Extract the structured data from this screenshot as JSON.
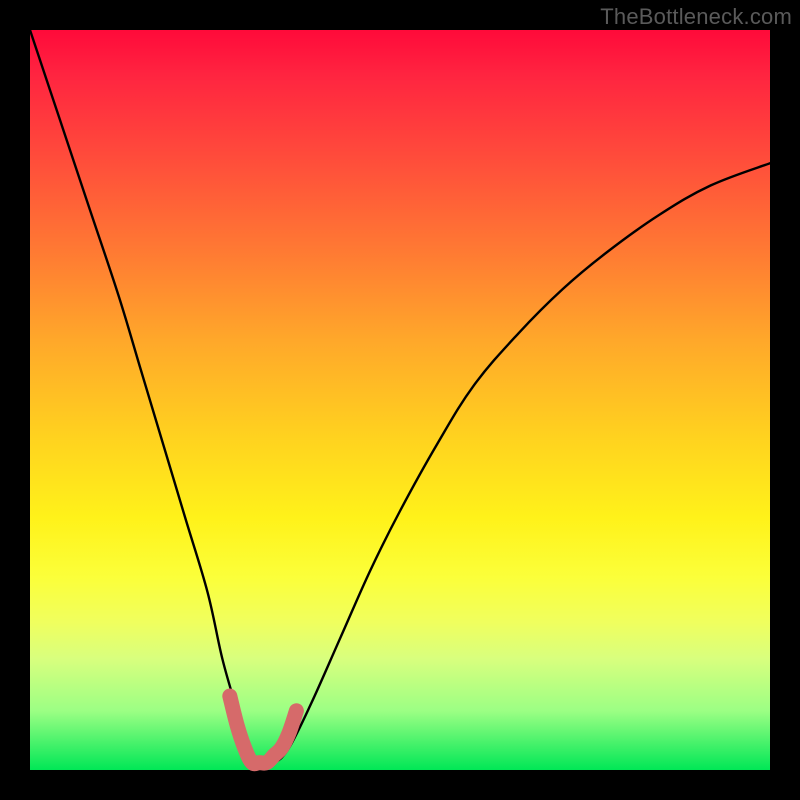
{
  "watermark": "TheBottleneck.com",
  "chart_data": {
    "type": "line",
    "title": "",
    "xlabel": "",
    "ylabel": "",
    "xlim": [
      0,
      100
    ],
    "ylim": [
      0,
      100
    ],
    "grid": false,
    "legend": false,
    "series": [
      {
        "name": "bottleneck-curve",
        "x": [
          0,
          4,
          8,
          12,
          15,
          18,
          21,
          24,
          26,
          28,
          29.5,
          31,
          33,
          35,
          38,
          42,
          46,
          50,
          55,
          60,
          66,
          72,
          78,
          85,
          92,
          100
        ],
        "y": [
          100,
          88,
          76,
          64,
          54,
          44,
          34,
          24,
          15,
          8,
          3,
          1,
          1,
          3,
          9,
          18,
          27,
          35,
          44,
          52,
          59,
          65,
          70,
          75,
          79,
          82
        ]
      },
      {
        "name": "trough-highlight",
        "x": [
          27,
          28,
          29,
          30,
          31,
          32,
          33,
          34,
          35,
          36
        ],
        "y": [
          10,
          6,
          3,
          1,
          1,
          1,
          2,
          3,
          5,
          8
        ]
      }
    ],
    "notes": "Values are approximate readings from an unlabeled bottleneck chart. x is an arbitrary horizontal percentage (0 = left edge, 100 = right edge). y is the curve height as a percentage of the plot area (0 = bottom/green, 100 = top/red). The trough-highlight series marks the salmon-colored emphasized segment near the minimum."
  },
  "colors": {
    "curve": "#000000",
    "highlight": "#d66a6a",
    "background_frame": "#000000"
  }
}
